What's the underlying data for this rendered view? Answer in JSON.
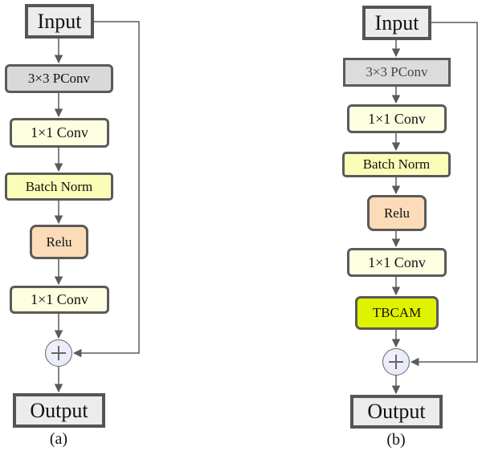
{
  "diagram_a": {
    "caption": "(a)",
    "nodes": {
      "input": "Input",
      "pconv": "3×3 PConv",
      "conv1": "1×1 Conv",
      "batchnorm": "Batch Norm",
      "relu": "Relu",
      "conv2": "1×1 Conv",
      "add": "add-icon",
      "output": "Output"
    }
  },
  "diagram_b": {
    "caption": "(b)",
    "nodes": {
      "input": "Input",
      "pconv": "3×3 PConv",
      "conv1": "1×1 Conv",
      "batchnorm": "Batch Norm",
      "relu": "Relu",
      "conv2": "1×1 Conv",
      "tbcam": "TBCAM",
      "add": "add-icon",
      "output": "Output"
    }
  },
  "colors": {
    "io": "#ececec",
    "pconv": "#d9d9d9",
    "conv": "#fefee0",
    "batchnorm": "#fbfcb8",
    "relu": "#fcdcb8",
    "tbcam": "#dff200",
    "edge": "#5a5a5a"
  }
}
